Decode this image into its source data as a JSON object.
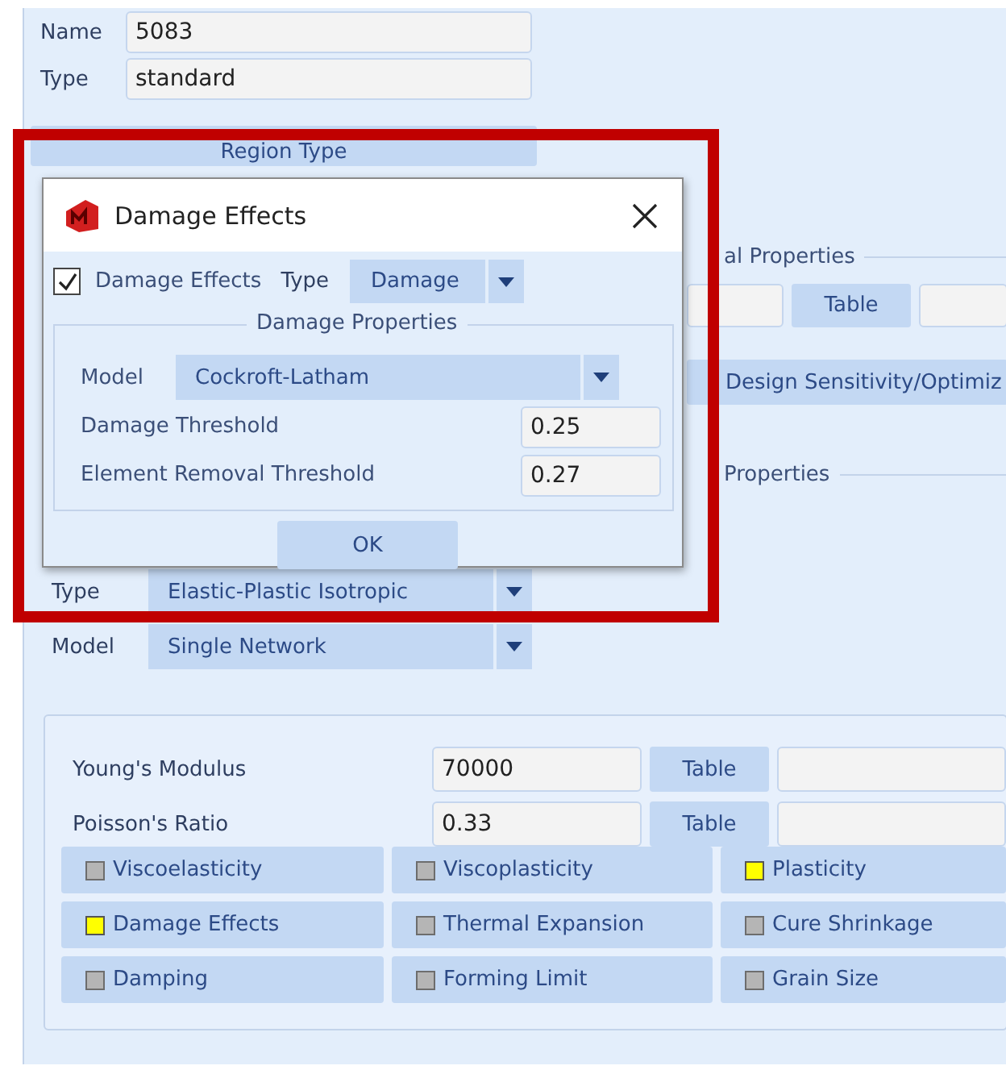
{
  "form": {
    "fields": [
      {
        "label": "Name",
        "value": "5083"
      },
      {
        "label": "Type",
        "value": "standard"
      }
    ],
    "region_type_button": "Region Type"
  },
  "background": {
    "section_heading": "al Properties",
    "table_button": "Table",
    "design_button": "Design Sensitivity/Optimiz",
    "second_heading": "Properties"
  },
  "material": {
    "dropdowns": [
      {
        "label": "Type",
        "value": "Elastic-Plastic Isotropic"
      },
      {
        "label": "Model",
        "value": "Single Network"
      }
    ],
    "properties": [
      {
        "label": "Young's Modulus",
        "value": "70000",
        "button": "Table"
      },
      {
        "label": "Poisson's Ratio",
        "value": "0.33",
        "button": "Table"
      }
    ],
    "toggles": [
      {
        "label": "Viscoelasticity",
        "on": false
      },
      {
        "label": "Viscoplasticity",
        "on": false
      },
      {
        "label": "Plasticity",
        "on": true
      },
      {
        "label": "Damage Effects",
        "on": true
      },
      {
        "label": "Thermal Expansion",
        "on": false
      },
      {
        "label": "Cure Shrinkage",
        "on": false
      },
      {
        "label": "Damping",
        "on": false
      },
      {
        "label": "Forming Limit",
        "on": false
      },
      {
        "label": "Grain Size",
        "on": false
      }
    ]
  },
  "dialog": {
    "title": "Damage Effects",
    "highlighted": true,
    "enable": {
      "label": "Damage Effects",
      "checked": true
    },
    "type_label": "Type",
    "type_value": "Damage",
    "group_title": "Damage Properties",
    "model_label": "Model",
    "model_value": "Cockroft-Latham",
    "thresholds": [
      {
        "label": "Damage Threshold",
        "value": "0.25"
      },
      {
        "label": "Element Removal Threshold",
        "value": "0.27"
      }
    ],
    "ok_button": "OK"
  }
}
